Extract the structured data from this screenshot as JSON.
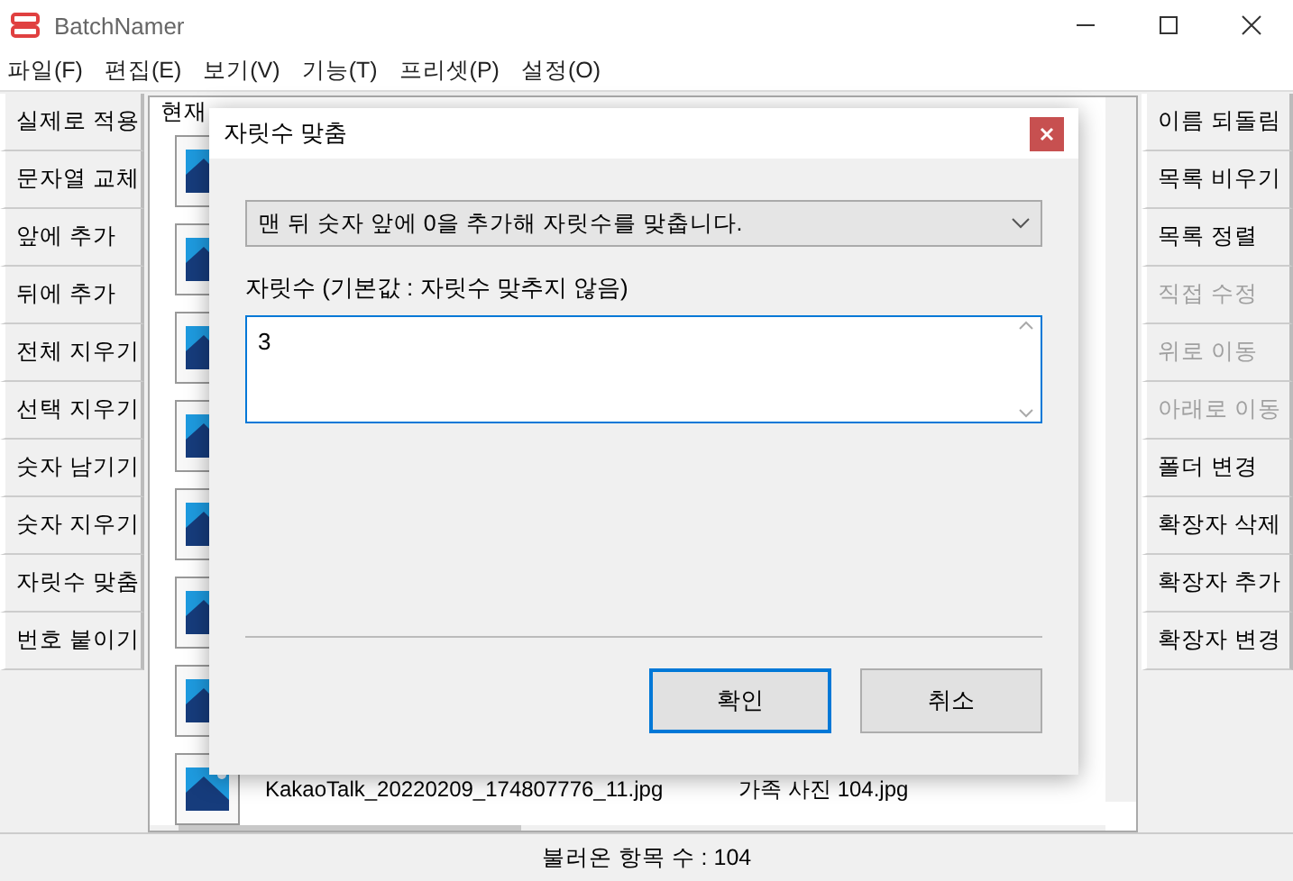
{
  "window": {
    "title": "BatchNamer"
  },
  "menu": [
    "파일(F)",
    "편집(E)",
    "보기(V)",
    "기능(T)",
    "프리셋(P)",
    "설정(O)"
  ],
  "left_buttons": [
    {
      "label": "실제로 적용",
      "disabled": false
    },
    {
      "label": "문자열 교체",
      "disabled": false
    },
    {
      "label": "앞에 추가",
      "disabled": false
    },
    {
      "label": "뒤에 추가",
      "disabled": false
    },
    {
      "label": "전체 지우기",
      "disabled": false
    },
    {
      "label": "선택 지우기",
      "disabled": false
    },
    {
      "label": "숫자 남기기",
      "disabled": false
    },
    {
      "label": "숫자 지우기",
      "disabled": false
    },
    {
      "label": "자릿수 맞춤",
      "disabled": false
    },
    {
      "label": "번호 붙이기",
      "disabled": false
    }
  ],
  "right_buttons": [
    {
      "label": "이름 되돌림",
      "disabled": false
    },
    {
      "label": "목록 비우기",
      "disabled": false
    },
    {
      "label": "목록 정렬",
      "disabled": false
    },
    {
      "label": "직접 수정",
      "disabled": true
    },
    {
      "label": "위로 이동",
      "disabled": true
    },
    {
      "label": "아래로 이동",
      "disabled": true
    },
    {
      "label": "폴더 변경",
      "disabled": false
    },
    {
      "label": "확장자 삭제",
      "disabled": false
    },
    {
      "label": "확장자 추가",
      "disabled": false
    },
    {
      "label": "확장자 변경",
      "disabled": false
    }
  ],
  "file_list": {
    "column_header": "현재",
    "last_row": {
      "current": "KakaoTalk_20220209_174807776_11.jpg",
      "new": "가족 사진 104.jpg"
    }
  },
  "dialog": {
    "title": "자릿수 맞춤",
    "dropdown": "맨 뒤 숫자 앞에 0을 추가해 자릿수를 맞춥니다.",
    "field_label": "자릿수 (기본값 : 자릿수 맞추지 않음)",
    "field_value": "3",
    "buttons": [
      {
        "label": "확인",
        "focused": true
      },
      {
        "label": "취소",
        "focused": false
      }
    ]
  },
  "status_bar": "불러온 항목 수 : 104"
}
